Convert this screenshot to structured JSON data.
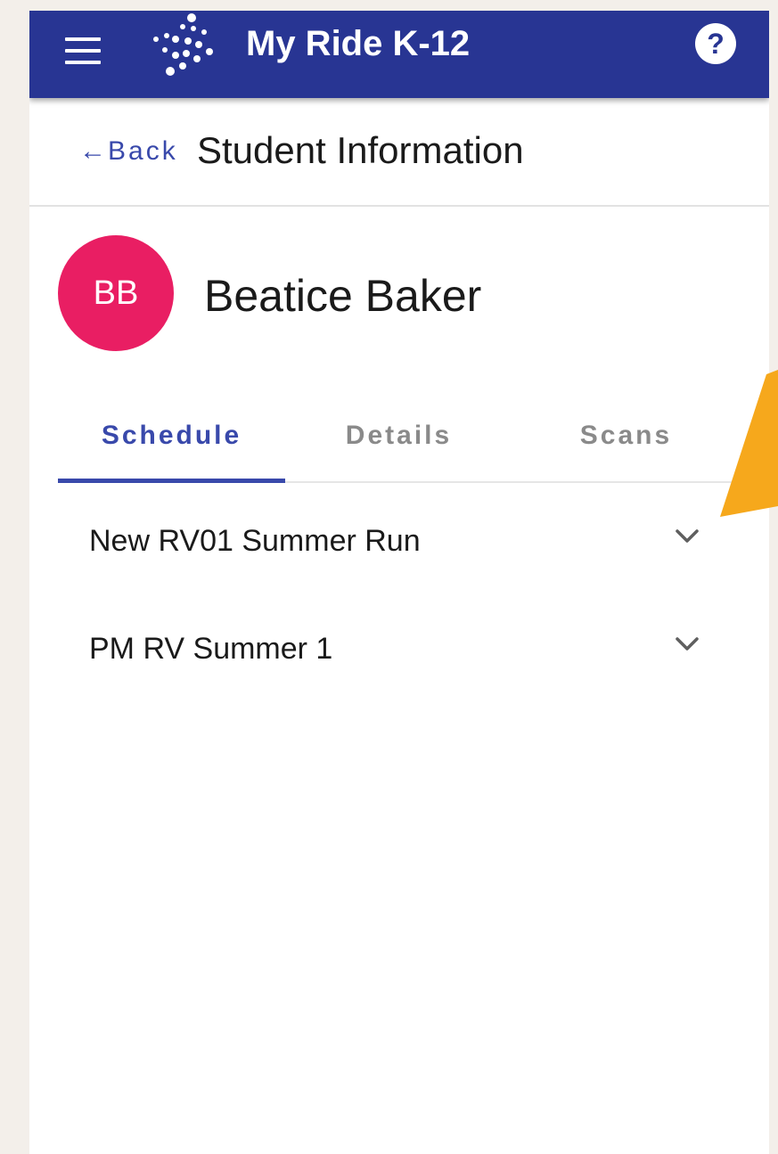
{
  "colors": {
    "app_bar": "#283593",
    "accent": "#3949ab",
    "avatar_bg": "#e91e63",
    "callout": "#f6a81c",
    "backdrop": "#f3efea"
  },
  "app_bar": {
    "menu_icon": "hamburger-menu-icon",
    "logo_icon": "dots-logo-icon",
    "title": "My Ride K-12",
    "help_icon": "help-circle-icon",
    "help_glyph": "?"
  },
  "header": {
    "back_arrow": "←",
    "back_label": "Back",
    "title": "Student Information"
  },
  "student": {
    "initials": "BB",
    "name": "Beatice Baker"
  },
  "tabs": [
    {
      "label": "Schedule",
      "active": true
    },
    {
      "label": "Details",
      "active": false
    },
    {
      "label": "Scans",
      "active": false
    }
  ],
  "routes": [
    {
      "name": "New RV01 Summer Run",
      "icon": "chevron-down-icon"
    },
    {
      "name": "PM RV Summer 1",
      "icon": "chevron-down-icon"
    }
  ]
}
